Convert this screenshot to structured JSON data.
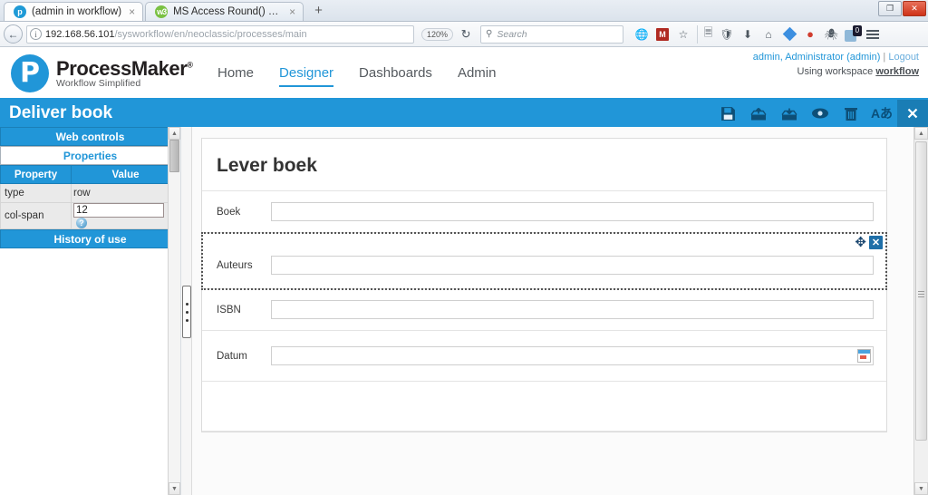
{
  "browser": {
    "tabs": [
      {
        "label": "(admin in workflow)",
        "favicon": "processmaker-favicon",
        "active": true,
        "close_label": "×"
      },
      {
        "label": "MS Access Round() Function",
        "favicon": "green-favicon",
        "active": false,
        "close_label": "×"
      }
    ],
    "new_tab_label": "+",
    "window_controls": {
      "restore_label": "❐",
      "close_label": "✕"
    },
    "back_label": "←",
    "url": {
      "host": "192.168.56.101",
      "path": "/sysworkflow/en/neoclassic/processes/main"
    },
    "zoom_level": "120%",
    "reload_label": "↻",
    "search_placeholder": "Search",
    "search_value": "",
    "toolbar_icons": [
      "globe-icon",
      "adblock-icon",
      "bookmark-star-icon",
      "reading-list-icon",
      "shield-icon",
      "downloads-icon",
      "home-icon",
      "sync-diamond-icon",
      "location-pin-icon",
      "noscript-icon",
      "extension-badge-icon",
      "menu-icon"
    ],
    "extension_badge_count": "0"
  },
  "app": {
    "brand": {
      "name": "ProcessMaker",
      "registered": "®",
      "tagline": "Workflow Simplified",
      "logo_letter": "P",
      "accent": "#2196d8"
    },
    "nav": [
      {
        "label": "Home",
        "active": false
      },
      {
        "label": "Designer",
        "active": true
      },
      {
        "label": "Dashboards",
        "active": false
      },
      {
        "label": "Admin",
        "active": false
      }
    ],
    "user": {
      "account": "admin, Administrator (admin)",
      "separator": "|",
      "logout": "Logout",
      "workspace_prefix": "Using workspace",
      "workspace": "workflow"
    }
  },
  "designer": {
    "title": "Deliver book",
    "tools": [
      {
        "name": "save-icon",
        "title": "Save"
      },
      {
        "name": "upload-icon",
        "title": "Import"
      },
      {
        "name": "download-icon",
        "title": "Export"
      },
      {
        "name": "preview-eye-icon",
        "title": "Preview"
      },
      {
        "name": "delete-trash-icon",
        "title": "Delete"
      },
      {
        "name": "language-icon",
        "title": "Aあ"
      },
      {
        "name": "close-icon",
        "title": "Close"
      }
    ],
    "language_glyph": "Aあ",
    "close_glyph": "✕"
  },
  "sidebar": {
    "web_controls_label": "Web controls",
    "properties_label": "Properties",
    "history_label": "History of use",
    "property_table": {
      "headers": [
        "Property",
        "Value"
      ],
      "rows": [
        {
          "property": "type",
          "value": "row",
          "editable": false
        },
        {
          "property": "col-span",
          "value": "12",
          "editable": true,
          "help": "?"
        }
      ]
    }
  },
  "form": {
    "title": "Lever boek",
    "fields": [
      {
        "label": "Boek",
        "value": "",
        "type": "text",
        "selected": false
      },
      {
        "label": "Auteurs",
        "value": "",
        "type": "text",
        "selected": true,
        "move_glyph": "✥",
        "delete_glyph": "✕"
      },
      {
        "label": "ISBN",
        "value": "",
        "type": "text",
        "selected": false
      },
      {
        "label": "Datum",
        "value": "",
        "type": "date",
        "selected": false,
        "calendar_icon": "calendar-icon"
      },
      {
        "label": "",
        "value": "",
        "type": "empty",
        "selected": false
      }
    ]
  },
  "scrollbars": {
    "up_arrow": "▲",
    "down_arrow": "▼"
  }
}
